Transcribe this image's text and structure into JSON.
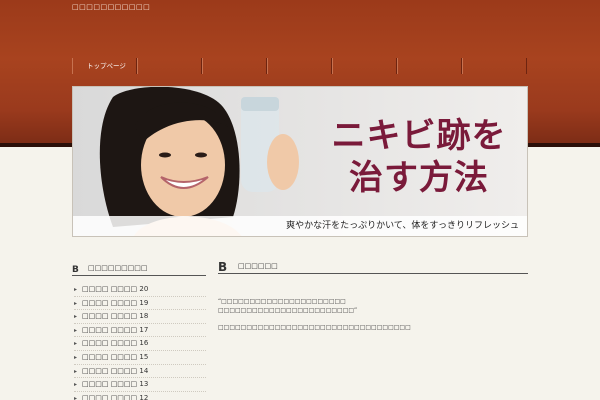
{
  "site": {
    "title": "□□□□□□□□□□□"
  },
  "nav": {
    "items": [
      {
        "label": "トップページ"
      },
      {
        "label": ""
      },
      {
        "label": ""
      },
      {
        "label": ""
      },
      {
        "label": ""
      },
      {
        "label": ""
      },
      {
        "label": ""
      }
    ]
  },
  "hero": {
    "title_line1": "ニキビ跡を",
    "title_line2": "治す方法",
    "tagline": "爽やかな汗をたっぷりかいて、体をすっきりリフレッシュ"
  },
  "sidebar": {
    "heading": "□□□□□□□□□",
    "items": [
      {
        "label": "□□□□ □□□□ 20"
      },
      {
        "label": "□□□□ □□□□ 19"
      },
      {
        "label": "□□□□ □□□□ 18"
      },
      {
        "label": "□□□□ □□□□ 17"
      },
      {
        "label": "□□□□ □□□□ 16"
      },
      {
        "label": "□□□□ □□□□ 15"
      },
      {
        "label": "□□□□ □□□□ 14"
      },
      {
        "label": "□□□□ □□□□ 13"
      },
      {
        "label": "□□□□ □□□□ 12"
      }
    ]
  },
  "main": {
    "heading": "□□□□□□",
    "paragraph1_line1": "“□□□□□□□□□□□□□□□□□□□□□□",
    "paragraph1_line2": "□□□□□□□□□□□□□□□□□□□□□□□□”",
    "paragraph2": "□□□□□□□□□□□□□□□□□□□□□□□□□□□□□□□□□□"
  },
  "colors": {
    "header_band": "#a8431f",
    "hero_title": "#7a1a3a",
    "page_bg": "#f5f3ec"
  }
}
